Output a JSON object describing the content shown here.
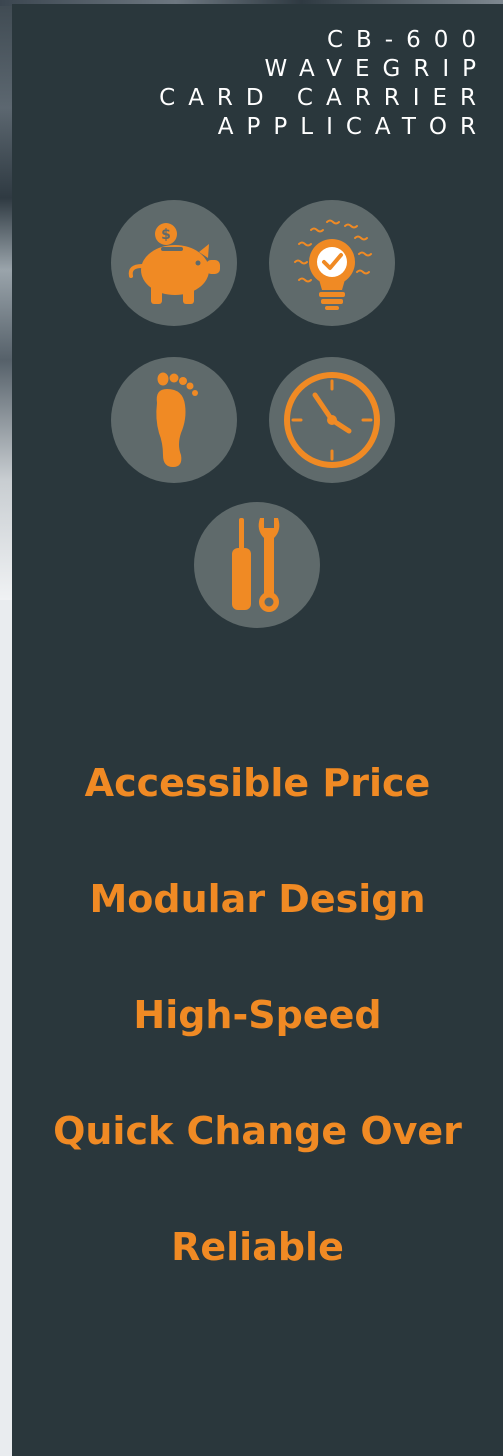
{
  "header": {
    "title_lines": [
      "CB-600",
      "WAVEGRIP",
      "CARD CARRIER",
      "APPLICATOR"
    ]
  },
  "icons": [
    {
      "name": "piggy-bank-icon"
    },
    {
      "name": "lightbulb-check-icon"
    },
    {
      "name": "footprint-icon"
    },
    {
      "name": "clock-icon"
    },
    {
      "name": "tools-icon"
    }
  ],
  "features": [
    {
      "label": "Accessible Price"
    },
    {
      "label": "Modular Design"
    },
    {
      "label": "High-Speed"
    },
    {
      "label": "Quick Change Over"
    },
    {
      "label": "Reliable"
    }
  ],
  "colors": {
    "panel": "#2a373c",
    "accent": "#f08a24",
    "icon_circle": "#5f6a6b",
    "title_text": "#ffffff"
  }
}
